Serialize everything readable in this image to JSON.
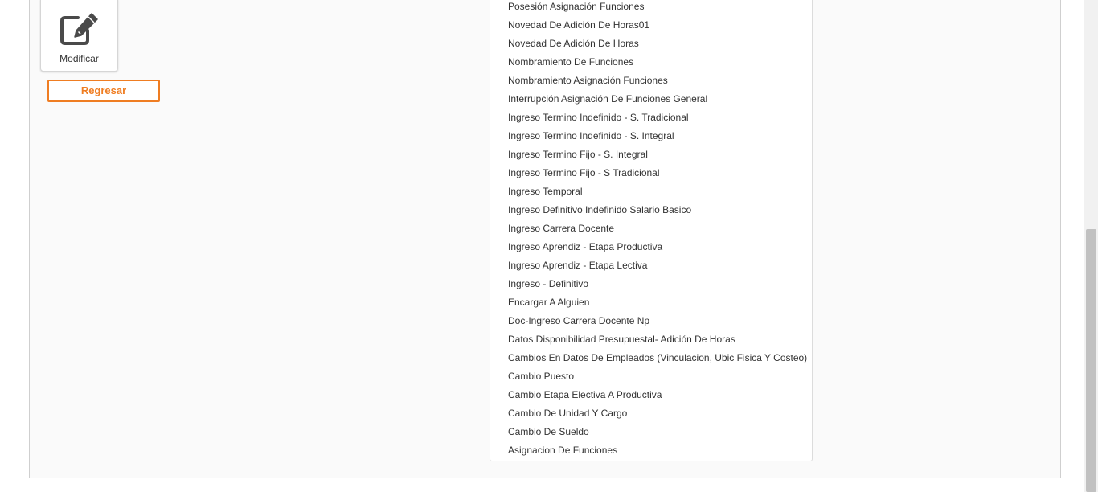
{
  "actions": {
    "modify_label": "Modificar",
    "modify_icon": "edit-square-pencil-icon",
    "back_label": "Regresar"
  },
  "options": [
    "Posesión Asignación Funciones",
    "Novedad De Adición De Horas01",
    "Novedad De Adición De Horas",
    "Nombramiento De Funciones",
    "Nombramiento Asignación Funciones",
    "Interrupción Asignación De Funciones General",
    "Ingreso Termino Indefinido - S. Tradicional",
    "Ingreso Termino Indefinido - S. Integral",
    "Ingreso Termino Fijo - S. Integral",
    "Ingreso Termino Fijo - S Tradicional",
    "Ingreso Temporal",
    "Ingreso Definitivo Indefinido Salario Basico",
    "Ingreso Carrera Docente",
    "Ingreso Aprendiz - Etapa Productiva",
    "Ingreso Aprendiz - Etapa Lectiva",
    "Ingreso - Definitivo",
    "Encargar A Alguien",
    "Doc-Ingreso Carrera Docente Np",
    "Datos Disponibilidad Presupuestal- Adición De Horas",
    "Cambios En Datos De Empleados (Vinculacion, Ubic Fisica Y Costeo)",
    "Cambio Puesto",
    "Cambio Etapa Electiva A Productiva",
    "Cambio De Unidad Y Cargo",
    "Cambio De Sueldo",
    "Asignacion De Funciones"
  ],
  "colors": {
    "accent": "#ef7d22",
    "text": "#333333",
    "icon": "#4a4a4a",
    "panel_background": "#fafafa"
  }
}
